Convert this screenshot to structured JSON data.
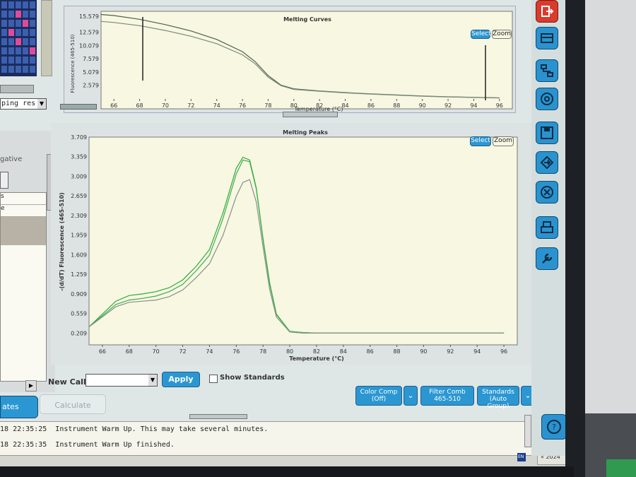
{
  "melting_curves": {
    "title": "Melting Curves",
    "select_label": "Select",
    "zoom_label": "Zoom",
    "y_label": "Fluorescence (465-510)",
    "x_label": "Temperature (°C)",
    "y_ticks": [
      "15.579",
      "12.579",
      "10.079",
      "7.579",
      "5.079",
      "2.579"
    ],
    "x_ticks": [
      "66",
      "68",
      "70",
      "72",
      "74",
      "76",
      "78",
      "80",
      "82",
      "84",
      "86",
      "88",
      "90",
      "92",
      "94",
      "96"
    ]
  },
  "melting_peaks": {
    "title": "Melting Peaks",
    "select_label": "Select",
    "zoom_label": "Zoom",
    "y_label": "-(d/dT) Fluorescence (465-510)",
    "x_label": "Temperature (°C)",
    "y_ticks": [
      "3.709",
      "3.359",
      "3.009",
      "2.659",
      "2.309",
      "1.959",
      "1.609",
      "1.259",
      "0.909",
      "0.559",
      "0.209"
    ],
    "x_ticks": [
      "66",
      "68",
      "70",
      "72",
      "74",
      "76",
      "78",
      "80",
      "82",
      "84",
      "86",
      "88",
      "90",
      "92",
      "94",
      "96"
    ]
  },
  "chart_data": [
    {
      "type": "line",
      "title": "Melting Curves",
      "xlabel": "Temperature (°C)",
      "ylabel": "Fluorescence (465-510)",
      "xlim": [
        65,
        97
      ],
      "ylim": [
        0,
        16.5
      ],
      "series": [
        {
          "x": [
            65,
            66,
            68,
            70,
            72,
            74,
            76,
            77,
            78,
            79,
            80,
            82,
            84,
            86,
            88,
            90,
            92,
            94,
            96
          ],
          "values": [
            15.9,
            15.7,
            15.0,
            14.0,
            12.8,
            11.2,
            8.9,
            7.0,
            4.4,
            2.6,
            1.9,
            1.5,
            1.2,
            0.95,
            0.75,
            0.55,
            0.4,
            0.3,
            0.2
          ]
        },
        {
          "x": [
            65,
            66,
            68,
            70,
            72,
            74,
            76,
            77,
            78,
            79,
            80,
            82,
            84,
            86,
            88,
            90,
            92,
            94,
            96
          ],
          "values": [
            14.6,
            14.4,
            13.8,
            12.9,
            11.8,
            10.4,
            8.3,
            6.6,
            4.1,
            2.5,
            1.8,
            1.45,
            1.15,
            0.9,
            0.72,
            0.52,
            0.38,
            0.28,
            0.18
          ]
        }
      ]
    },
    {
      "type": "line",
      "title": "Melting Peaks",
      "xlabel": "Temperature (°C)",
      "ylabel": "-(d/dT) Fluorescence (465-510)",
      "xlim": [
        65,
        97
      ],
      "ylim": [
        0.0,
        3.709
      ],
      "series": [
        {
          "x": [
            65,
            66,
            67,
            68,
            69,
            70,
            71,
            72,
            73,
            74,
            75,
            76,
            76.5,
            77,
            77.5,
            78,
            78.5,
            79,
            80,
            81,
            82,
            84,
            86,
            88,
            90,
            92,
            94,
            96
          ],
          "values": [
            0.32,
            0.55,
            0.78,
            0.88,
            0.91,
            0.95,
            1.02,
            1.16,
            1.4,
            1.7,
            2.35,
            3.15,
            3.35,
            3.3,
            2.8,
            1.9,
            1.1,
            0.55,
            0.24,
            0.22,
            0.21,
            0.21,
            0.21,
            0.21,
            0.21,
            0.21,
            0.21,
            0.21
          ]
        },
        {
          "x": [
            65,
            66,
            67,
            68,
            69,
            70,
            71,
            72,
            73,
            74,
            75,
            76,
            76.5,
            77,
            77.5,
            78,
            78.5,
            79,
            80,
            81,
            82,
            84,
            86,
            88,
            90,
            92,
            94,
            96
          ],
          "values": [
            0.32,
            0.52,
            0.72,
            0.8,
            0.83,
            0.87,
            0.95,
            1.08,
            1.32,
            1.6,
            2.25,
            3.05,
            3.3,
            3.27,
            2.78,
            1.88,
            1.08,
            0.54,
            0.24,
            0.22,
            0.21,
            0.21,
            0.21,
            0.21,
            0.21,
            0.21,
            0.21,
            0.21
          ]
        },
        {
          "x": [
            65,
            66,
            67,
            68,
            69,
            70,
            71,
            72,
            73,
            74,
            75,
            76,
            76.5,
            77,
            77.5,
            78,
            78.5,
            79,
            80,
            81,
            82,
            84,
            86,
            88,
            90,
            92,
            94,
            96
          ],
          "values": [
            0.32,
            0.5,
            0.68,
            0.76,
            0.78,
            0.8,
            0.86,
            0.98,
            1.2,
            1.45,
            1.95,
            2.65,
            2.9,
            2.95,
            2.55,
            1.75,
            0.98,
            0.5,
            0.23,
            0.21,
            0.21,
            0.21,
            0.21,
            0.21,
            0.21,
            0.21,
            0.21,
            0.21
          ]
        }
      ]
    }
  ],
  "controls": {
    "new_call_label": "New Call",
    "apply_label": "Apply",
    "show_standards_label": "Show Standards",
    "calculate_label": "Calculate",
    "color_comp_label": "Color Comp",
    "color_comp_value": "(Off)",
    "filter_comb_label": "Filter Comb",
    "filter_comb_value": "465-510",
    "standards_label": "Standards",
    "standards_value": "(Auto Group)"
  },
  "left_panel": {
    "dropdown_text": "ping res",
    "negative_label": "gative",
    "tab_label": "ates",
    "row_s": "s",
    "row_e": "e"
  },
  "log": [
    {
      "date": "18",
      "time": "22:35:25",
      "message": "Instrument Warm Up. This may take several minutes."
    },
    {
      "date": "18",
      "time": "22:35:35",
      "message": "Instrument Warm Up finished."
    }
  ],
  "status": {
    "lang": "EN",
    "clock": "« 2024"
  },
  "colors": {
    "series_green": "#2fa840",
    "series_gray": "#8a8f8a",
    "plot_bg": "#f7f7e2",
    "accent": "#2b97d2"
  },
  "toolbar_icons": [
    "exit-icon",
    "instrument-icon",
    "network-icon",
    "analysis-icon",
    "save-icon",
    "export-icon",
    "cancel-icon",
    "print-icon",
    "tools-icon",
    "help-icon"
  ]
}
